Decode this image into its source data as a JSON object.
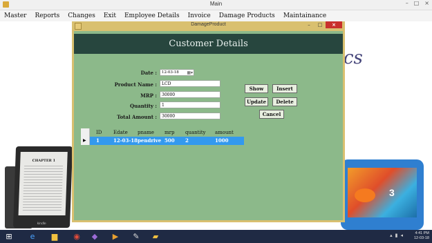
{
  "main_window": {
    "title": "Main",
    "controls": [
      "–",
      "□",
      "×"
    ],
    "menu": [
      "Master",
      "Reports",
      "Changes",
      "Exit",
      "Employee Details",
      "Invoice",
      "Damage Products",
      "Maintainance"
    ]
  },
  "background": {
    "brand_fragment": "cs",
    "kindle_chapter": "CHAPTER 1",
    "kindle_brand": "kindle",
    "tablet_badge": "3"
  },
  "form": {
    "title": "DamageProduct",
    "controls": {
      "minimize": "–",
      "maximize": "□",
      "close": "×"
    },
    "header": "Customer Details",
    "fields": {
      "date": {
        "label": "Date :",
        "value": "12-03-18"
      },
      "product_name": {
        "label": "Product Name :",
        "value": "LCD"
      },
      "mrp": {
        "label": "MRP :",
        "value": "30000"
      },
      "quantity": {
        "label": "Quantity :",
        "value": "1"
      },
      "total_amount": {
        "label": "Total Amount :",
        "value": "30000"
      }
    },
    "buttons": {
      "show": "Show",
      "insert": "Insert",
      "update": "Update",
      "delete": "Delete",
      "cancel": "Cancel"
    },
    "grid": {
      "columns": [
        "ID",
        "Edate",
        "pname",
        "mrp",
        "quantity",
        "amount"
      ],
      "rows": [
        {
          "pointer": "▶",
          "cells": [
            "1",
            "12-03-18",
            "pendrive",
            "500",
            "2",
            "1000"
          ]
        }
      ]
    }
  },
  "taskbar": {
    "time": "4:41 PM",
    "date": "12-03-18"
  }
}
